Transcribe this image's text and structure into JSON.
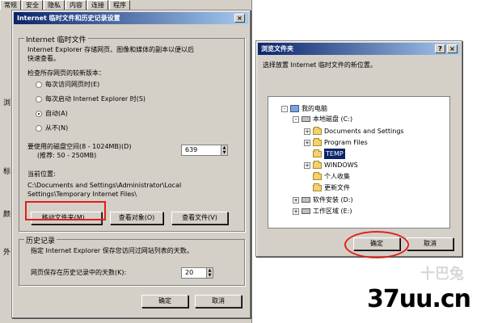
{
  "background_window": {
    "tabs": [
      "常规",
      "安全",
      "隐私",
      "内容",
      "连接",
      "程序"
    ],
    "side_fragments": [
      "浏",
      "标",
      "颜",
      "外"
    ]
  },
  "left_dialog": {
    "title": "Internet 临时文件和历史记录设置",
    "close": "×",
    "temp_group_label": "Internet 临时文件",
    "temp_desc_line1": "Internet Explorer 存储网页、图像和媒体的副本以便以后",
    "temp_desc_line2": "快速查看。",
    "check_label": "检查所存网页的较新版本：",
    "radios": [
      {
        "label": "每次访问网页时(E)",
        "checked": false
      },
      {
        "label": "每次启动 Internet Explorer 时(S)",
        "checked": false
      },
      {
        "label": "自动(A)",
        "checked": true
      },
      {
        "label": "从不(N)",
        "checked": false
      }
    ],
    "disk_label_line1": "要使用的磁盘空间(8 - 1024MB)(D)",
    "disk_label_line2": "(推荐: 50 - 250MB)",
    "disk_value": "639",
    "location_label": "当前位置:",
    "location_line1": "C:\\Documents and Settings\\Administrator\\Local",
    "location_line2": "Settings\\Temporary Internet Files\\",
    "move_folder_button": "移动文件夹(M)...",
    "view_objects_button": "查看对象(O)",
    "view_files_button": "查看文件(V)",
    "history_group_label": "历史记录",
    "history_desc": "指定 Internet Explorer 保存您访问过网站列表的天数。",
    "days_label": "网页保存在历史记录中的天数(K):",
    "days_value": "20",
    "ok_button": "确定",
    "cancel_button": "取消"
  },
  "right_dialog": {
    "title": "浏览文件夹",
    "help": "?",
    "close": "×",
    "instruction": "选择放置 Internet 临时文件的新位置。",
    "tree": [
      {
        "label": "我的电脑",
        "type": "pc",
        "expander": "-",
        "level": 0
      },
      {
        "label": "本地磁盘 (C:)",
        "type": "drive",
        "expander": "-",
        "level": 1
      },
      {
        "label": "Documents and Settings",
        "type": "folder",
        "expander": "+",
        "level": 2
      },
      {
        "label": "Program Files",
        "type": "folder",
        "expander": "+",
        "level": 2
      },
      {
        "label": "TEMP",
        "type": "folder",
        "expander": "",
        "level": 2,
        "selected": true
      },
      {
        "label": "WINDOWS",
        "type": "folder",
        "expander": "+",
        "level": 2
      },
      {
        "label": "个人收集",
        "type": "folder",
        "expander": "",
        "level": 2
      },
      {
        "label": "更新文件",
        "type": "folder",
        "expander": "",
        "level": 2
      },
      {
        "label": "软件安装 (D:)",
        "type": "drive",
        "expander": "+",
        "level": 1
      },
      {
        "label": "工作区域 (E:)",
        "type": "drive",
        "expander": "+",
        "level": 1
      }
    ],
    "ok_button": "确定",
    "cancel_button": "取消"
  },
  "watermark": {
    "text": "37uu.cn",
    "faint_text": "十巴兔"
  }
}
